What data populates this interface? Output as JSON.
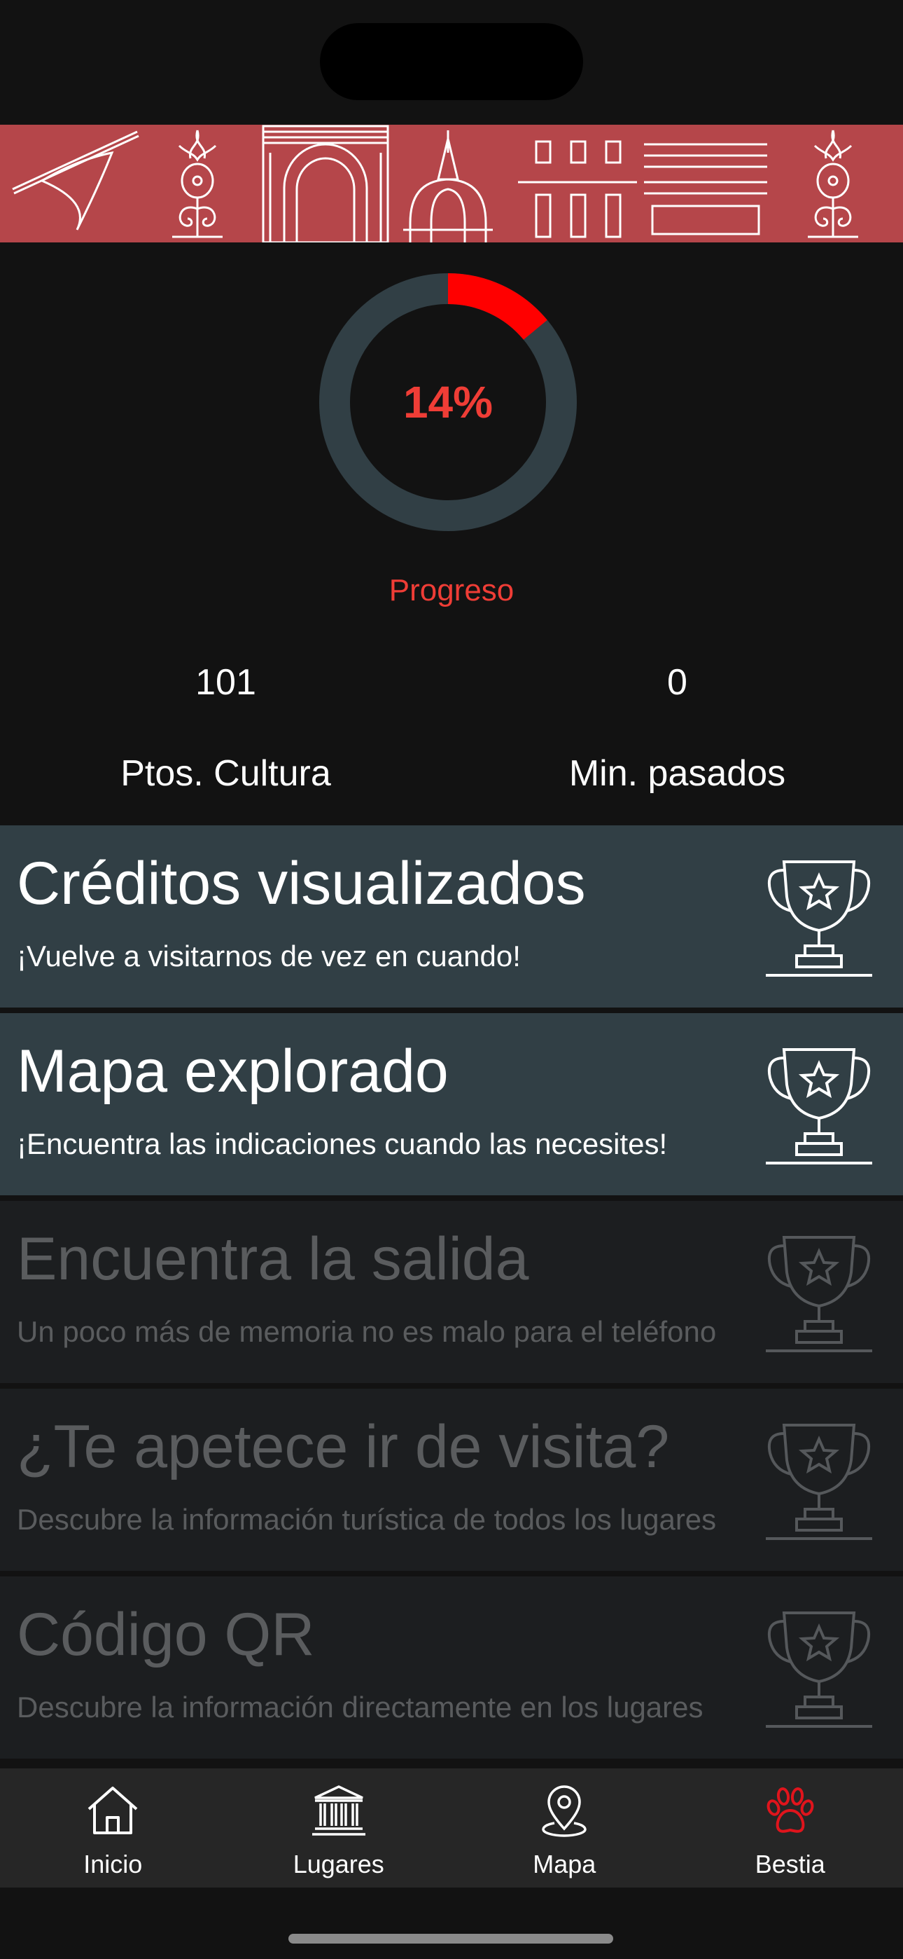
{
  "progress": {
    "percent_text": "14%",
    "value": 0.14,
    "label": "Progreso",
    "colors": {
      "accent": "#ff0000",
      "track": "#313f45",
      "text": "#ef3d36"
    }
  },
  "stats": [
    {
      "value": "101",
      "label": "Ptos. Cultura"
    },
    {
      "value": "0",
      "label": "Min. pasados"
    }
  ],
  "achievements": [
    {
      "title": "Créditos visualizados",
      "description": "¡Vuelve a visitarnos de vez en cuando!",
      "unlocked": true,
      "icon": "trophy-icon"
    },
    {
      "title": "Mapa explorado",
      "description": "¡Encuentra las indicaciones cuando las necesites!",
      "unlocked": true,
      "icon": "trophy-icon"
    },
    {
      "title": "Encuentra la salida",
      "description": "Un poco más de memoria no es malo para el teléfono",
      "unlocked": false,
      "icon": "trophy-icon"
    },
    {
      "title": "¿Te apetece ir de visita?",
      "description": "Descubre la información turística de todos los lugares",
      "unlocked": false,
      "icon": "trophy-icon"
    },
    {
      "title": "Código QR",
      "description": "Descubre la información directamente en los lugares",
      "unlocked": false,
      "icon": "trophy-icon"
    }
  ],
  "tabbar": {
    "items": [
      {
        "label": "Inicio",
        "icon": "home-icon"
      },
      {
        "label": "Lugares",
        "icon": "building-columns-icon"
      },
      {
        "label": "Mapa",
        "icon": "map-pin-icon"
      },
      {
        "label": "Bestia",
        "icon": "paw-icon",
        "active": true
      }
    ],
    "active_color": "#e0141c"
  },
  "banner": {
    "color": "#b5464a"
  }
}
